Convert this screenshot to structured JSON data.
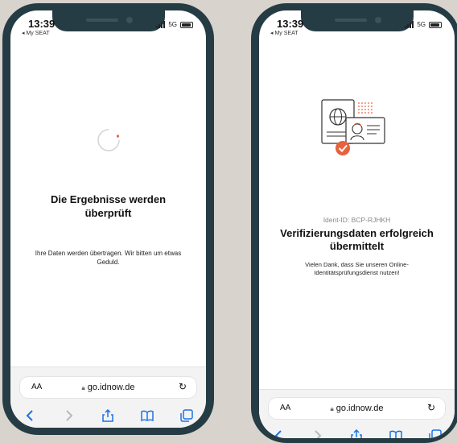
{
  "phone_left": {
    "status_bar": {
      "time": "13:39",
      "back_label": "◂ My SEAT",
      "network": "5G"
    },
    "title": "Die Ergebnisse werden überprüft",
    "message": "Ihre Daten werden übertragen. Wir bitten um etwas Geduld.",
    "browser": {
      "aa_label": "AA",
      "url": "go.idnow.de"
    }
  },
  "phone_right": {
    "status_bar": {
      "time": "13:39",
      "back_label": "◂ My SEAT",
      "network": "5G"
    },
    "ident_id": "Ident-ID: BCP-RJHKH",
    "title": "Verifizierungsdaten erfolgreich übermittelt",
    "message": "Vielen Dank, dass Sie unseren Online-Identitätsprüfungsdienst nutzen!",
    "browser": {
      "aa_label": "AA",
      "url": "go.idnow.de"
    }
  },
  "colors": {
    "background": "#d8d3cd",
    "phone_frame": "#253c44",
    "accent_orange": "#e8613c",
    "link_blue": "#1a73e8"
  },
  "icons": [
    "signal-icon",
    "battery-icon",
    "loading-spinner-icon",
    "lock-icon",
    "reload-icon",
    "back-arrow-icon",
    "forward-arrow-icon",
    "share-icon",
    "bookmarks-icon",
    "tabs-icon",
    "identity-documents-illustration",
    "checkmark-badge-icon"
  ]
}
